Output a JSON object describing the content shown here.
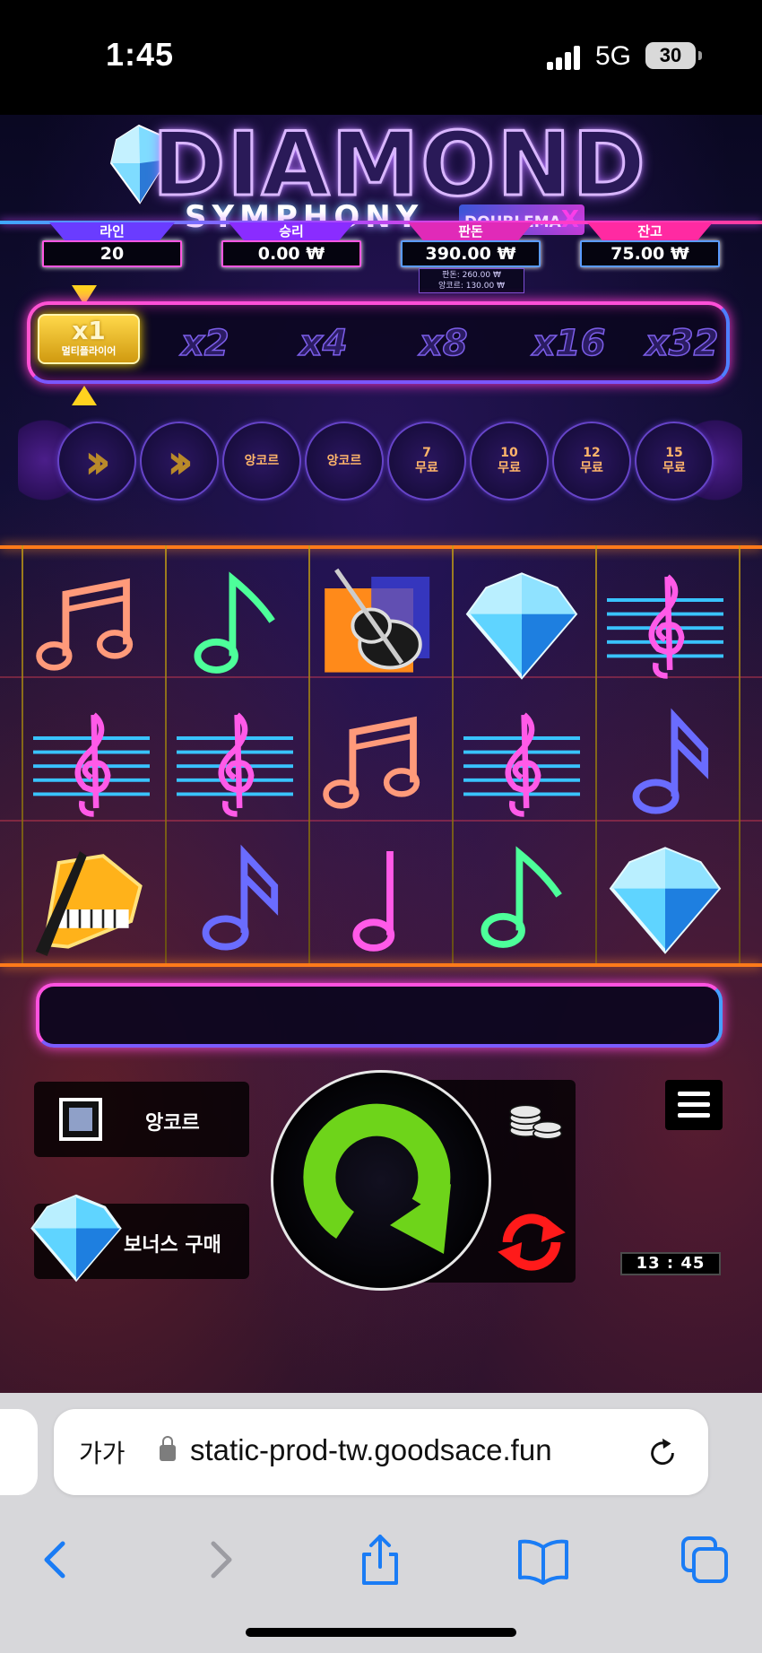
{
  "status_bar": {
    "time": "1:45",
    "network": "5G",
    "battery": "30"
  },
  "game": {
    "logo": {
      "title": "DIAMOND",
      "subtitle": "SYMPHONY",
      "badge_prefix": "DOUBLEMA",
      "badge_suffix": "X"
    },
    "stats": [
      {
        "label": "라인",
        "value": "20",
        "color": "#6a3cff"
      },
      {
        "label": "승리",
        "value": "0.00 ₩",
        "color": "#8a2cff"
      },
      {
        "label": "판돈",
        "value": "390.00 ₩",
        "color": "#e02ab8"
      },
      {
        "label": "잔고",
        "value": "75.00 ₩",
        "color": "#ff2aa2"
      }
    ],
    "bet_breakdown": {
      "line1": "판돈: 260.00 ₩",
      "line2": "앙코르: 130.00 ₩"
    },
    "multipliers": {
      "active": "x1",
      "active_caption": "멀티플라이어",
      "others": [
        "x2",
        "x4",
        "x8",
        "x16",
        "x32"
      ]
    },
    "feature_steps": [
      "앙코르",
      "앙코르",
      "7\n무료",
      "10\n무료",
      "12\n무료",
      "15\n무료"
    ],
    "reels": [
      [
        "note-orange",
        "clef-blue",
        "piano-gold"
      ],
      [
        "note-green",
        "clef-blue",
        "note-purple"
      ],
      [
        "violin",
        "note-orange",
        "note-pink"
      ],
      [
        "diamond",
        "clef-blue",
        "note-green"
      ],
      [
        "clef-blue",
        "note-purple",
        "diamond"
      ]
    ],
    "controls": {
      "encore_label": "앙코르",
      "bonus_buy_label": "보너스 구매",
      "timer": "13 : 45",
      "icons": [
        "checkbox-icon",
        "coins-icon",
        "autoplay-icon",
        "menu-icon",
        "spin-icon"
      ]
    },
    "colors": {
      "neon_pink": "#ff4fd8",
      "neon_blue": "#4f7fff",
      "gold": "#ffd84a",
      "spin_green": "#6ed41a"
    }
  },
  "browser": {
    "text_size_label": "가가",
    "url": "static-prod-tw.goodsace.fun",
    "toolbar_icons": [
      "back-icon",
      "forward-icon",
      "share-icon",
      "bookmarks-icon",
      "tabs-icon"
    ]
  }
}
